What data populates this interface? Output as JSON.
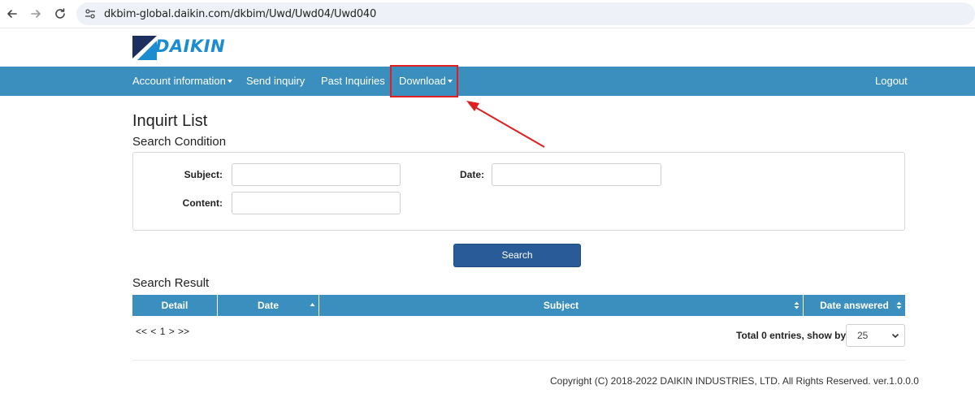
{
  "browser": {
    "url": "dkbim-global.daikin.com/dkbim/Uwd/Uwd04/Uwd040",
    "back_icon": "arrow-left-icon",
    "forward_icon": "arrow-right-icon",
    "reload_icon": "reload-icon",
    "site_info_icon": "tune-icon"
  },
  "logo": {
    "text": "DAIKIN",
    "color": "#1a8ccf"
  },
  "navbar": {
    "color": "#3a8fbe",
    "items": [
      {
        "label": "Account information",
        "dropdown": true
      },
      {
        "label": "Send inquiry",
        "dropdown": false
      },
      {
        "label": "Past Inquiries",
        "dropdown": false
      },
      {
        "label": "Download",
        "dropdown": true,
        "highlighted": true
      }
    ],
    "logout_label": "Logout"
  },
  "annotation": {
    "color": "#e02020"
  },
  "page": {
    "title": "Inquirt List",
    "search_condition_title": "Search Condition",
    "search_result_title": "Search Result"
  },
  "search_form": {
    "subject_label": "Subject:",
    "subject_value": "",
    "date_label": "Date:",
    "date_value": "",
    "content_label": "Content:",
    "content_value": "",
    "search_button_label": "Search"
  },
  "results_table": {
    "columns": [
      {
        "label": "Detail",
        "sortable": false
      },
      {
        "label": "Date",
        "sortable": true,
        "sort": "asc"
      },
      {
        "label": "Subject",
        "sortable": true
      },
      {
        "label": "Date answered",
        "sortable": true
      }
    ],
    "rows": []
  },
  "pagination": {
    "text": "<< < 1 > >>",
    "total_label": "Total 0 entries, show by",
    "page_size": "25",
    "page_size_options": [
      "25"
    ]
  },
  "footer": {
    "copyright": "Copyright (C) 2018-2022 DAIKIN INDUSTRIES, LTD. All Rights Reserved. ver.1.0.0.0"
  }
}
